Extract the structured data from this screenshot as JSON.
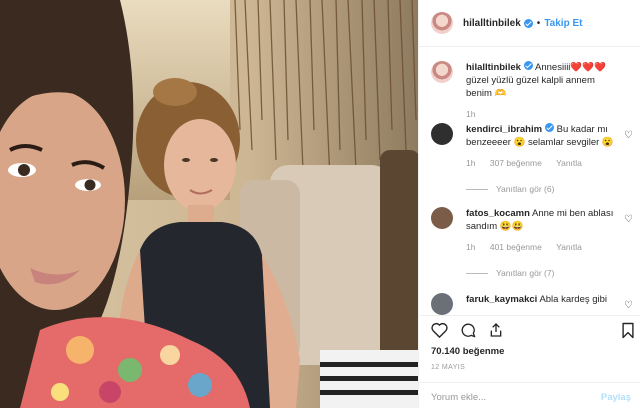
{
  "post": {
    "author": "hilalltinbilek",
    "follow_label": "Takip Et",
    "dot": "•",
    "caption": "Annesiiii❤️❤️❤️ güzel yüzlü güzel kalpli annem benim 🫶",
    "caption_time": "1h"
  },
  "comments": [
    {
      "user": "kendirci_ibrahim",
      "verified": true,
      "text": "Bu kadar mı benzeeeer 😮 selamlar sevgiler 😮",
      "time": "1h",
      "likes": "307 beğenme",
      "reply_label": "Yanıtla",
      "more": "Yanıtları gör (6)"
    },
    {
      "user": "fatos_kocamn",
      "verified": false,
      "text": "Anne mi ben ablası sandım 😃😃",
      "time": "1h",
      "likes": "401 beğenme",
      "reply_label": "Yanıtla",
      "more": "Yanıtları gör (7)"
    },
    {
      "user": "faruk_kaymakci",
      "verified": false,
      "text": "Abla kardeş gibi"
    }
  ],
  "footer": {
    "likes": "70.140 beğenme",
    "date": "12 MAYIS",
    "comment_placeholder": "Yorum ekle...",
    "share_label": "Paylaş"
  },
  "icons": {
    "heart": "heart-icon",
    "comment": "comment-icon",
    "share": "share-icon",
    "bookmark": "bookmark-icon",
    "verified": "verified-badge-icon"
  },
  "colors": {
    "accent": "#3897f0",
    "muted": "#999999",
    "border": "#efefef"
  }
}
